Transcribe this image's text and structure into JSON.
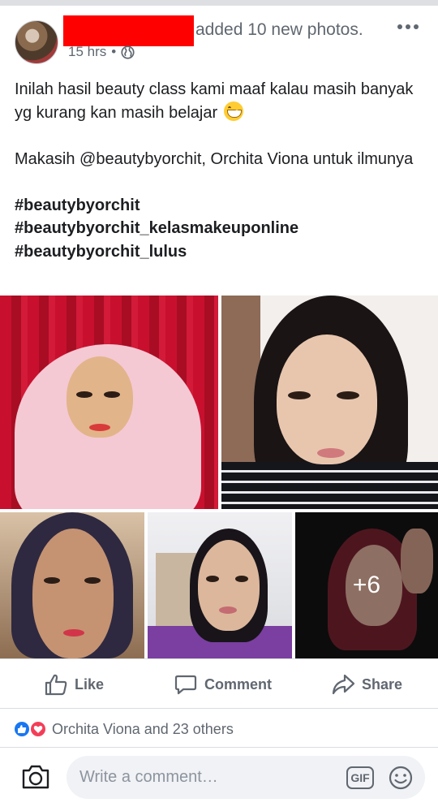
{
  "post": {
    "action_text": "added 10 new photos.",
    "timestamp": "15 hrs",
    "meta_separator": "•",
    "text_line1": "Inilah hasil beauty class kami maaf kalau masih banyak yg kurang kan masih belajar",
    "text_line2": "Makasih @beautybyorchit, Orchita Viona untuk ilmunya",
    "hashtags": [
      "#beautybyorchit",
      "#beautybyorchit_kelasmakeuponline",
      "#beautybyorchit_lulus"
    ]
  },
  "photos": {
    "more_count": "+6"
  },
  "actions": {
    "like": "Like",
    "comment": "Comment",
    "share": "Share"
  },
  "reactions": {
    "summary": "Orchita Viona and 23 others"
  },
  "comment_bar": {
    "placeholder": "Write a comment…",
    "gif_label": "GIF"
  },
  "colors": {
    "redaction": "#ff0000",
    "like_blue": "#1877f2",
    "love_red": "#f33e58",
    "secondary_text": "#606770"
  },
  "icons": [
    "globe-icon",
    "more-icon",
    "like-icon",
    "comment-icon",
    "share-icon",
    "camera-icon",
    "gif-icon",
    "sticker-icon"
  ]
}
